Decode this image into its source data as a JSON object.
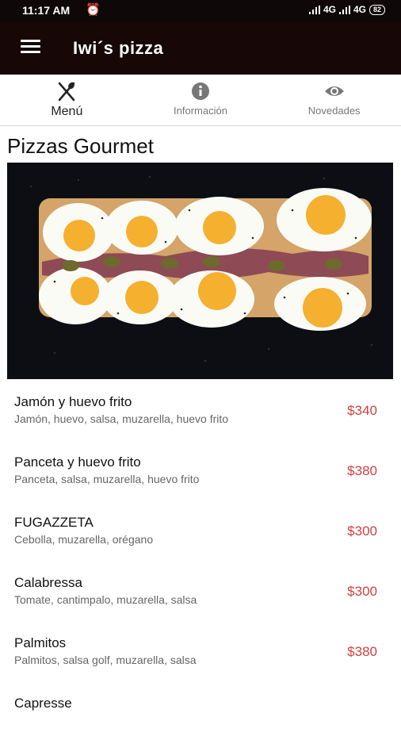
{
  "status": {
    "time": "11:17 AM",
    "network1": "4G",
    "network2": "4G",
    "battery": "82"
  },
  "appbar": {
    "title": "Iwi´s pizza"
  },
  "tabs": [
    {
      "label": "Menú",
      "icon": "utensils-icon",
      "active": true
    },
    {
      "label": "Información",
      "icon": "info-icon",
      "active": false
    },
    {
      "label": "Novedades",
      "icon": "eye-icon",
      "active": false
    }
  ],
  "section": {
    "title": "Pizzas Gourmet"
  },
  "items": [
    {
      "name": "Jamón y huevo frito",
      "desc": "Jamón, huevo, salsa, muzarella, huevo frito",
      "price": "$340"
    },
    {
      "name": "Panceta y huevo frito",
      "desc": "Panceta, salsa, muzarella, huevo frito",
      "price": "$380"
    },
    {
      "name": "FUGAZZETA",
      "desc": "Cebolla, muzarella, orégano",
      "price": "$300"
    },
    {
      "name": "Calabressa",
      "desc": "Tomate, cantimpalo, muzarella, salsa",
      "price": "$300"
    },
    {
      "name": "Palmitos",
      "desc": "Palmitos, salsa golf, muzarella, salsa",
      "price": "$380"
    },
    {
      "name": "Capresse",
      "desc": "",
      "price": ""
    }
  ],
  "colors": {
    "appbar": "#170707",
    "price": "#d04040"
  }
}
